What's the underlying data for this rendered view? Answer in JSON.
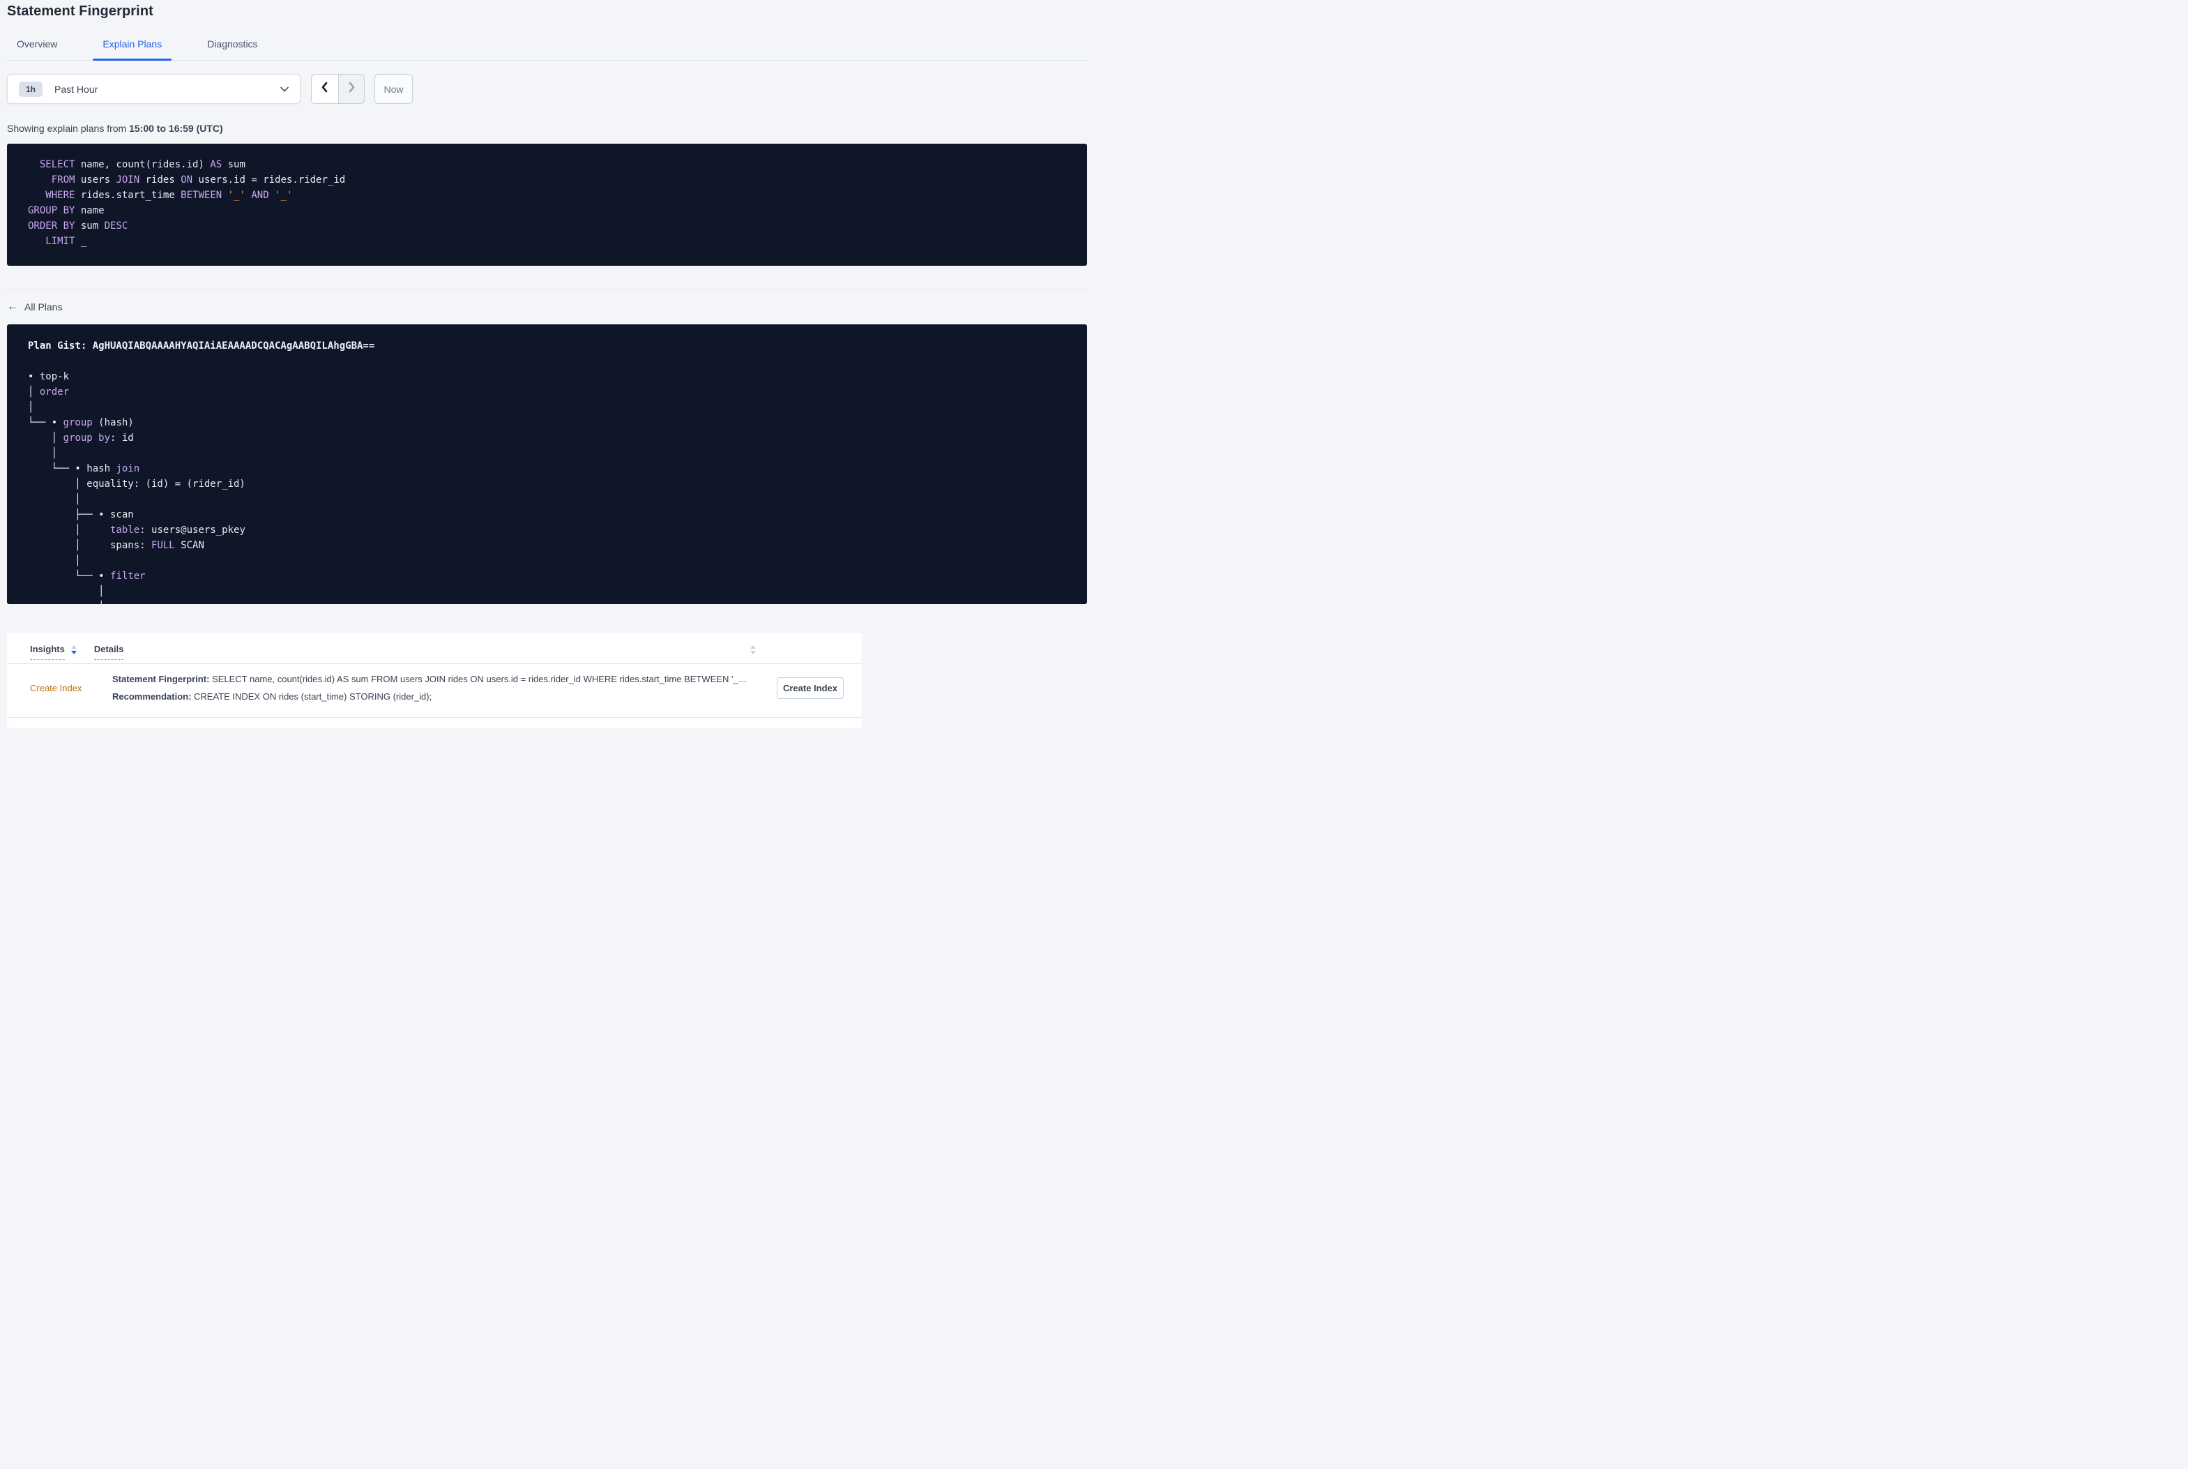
{
  "title": "Statement Fingerprint",
  "tabs": {
    "overview": "Overview",
    "explain_plans": "Explain Plans",
    "diagnostics": "Diagnostics"
  },
  "time_controls": {
    "badge": "1h",
    "selected": "Past Hour",
    "now": "Now"
  },
  "subtitle": {
    "prefix": "Showing explain plans from ",
    "range": "15:00 to 16:59 (UTC)"
  },
  "sql_box": {
    "lines": [
      [
        [
          "t",
          "  "
        ],
        [
          "k",
          "SELECT"
        ],
        [
          "t",
          " name, count(rides.id) "
        ],
        [
          "k",
          "AS"
        ],
        [
          "t",
          " sum"
        ]
      ],
      [
        [
          "t",
          "    "
        ],
        [
          "k",
          "FROM"
        ],
        [
          "t",
          " users "
        ],
        [
          "k",
          "JOIN"
        ],
        [
          "t",
          " rides "
        ],
        [
          "k",
          "ON"
        ],
        [
          "t",
          " users.id = rides.rider_id"
        ]
      ],
      [
        [
          "t",
          "   "
        ],
        [
          "k",
          "WHERE"
        ],
        [
          "t",
          " rides.start_time "
        ],
        [
          "k",
          "BETWEEN"
        ],
        [
          "t",
          " "
        ],
        [
          "s",
          "'_'"
        ],
        [
          "t",
          " "
        ],
        [
          "k",
          "AND"
        ],
        [
          "t",
          " "
        ],
        [
          "s",
          "'_'"
        ]
      ],
      [
        [
          "k",
          "GROUP BY"
        ],
        [
          "t",
          " name"
        ]
      ],
      [
        [
          "k",
          "ORDER BY"
        ],
        [
          "t",
          " sum "
        ],
        [
          "k",
          "DESC"
        ]
      ],
      [
        [
          "t",
          "   "
        ],
        [
          "k",
          "LIMIT"
        ],
        [
          "t",
          " _"
        ]
      ]
    ]
  },
  "back_link": {
    "label": "All Plans"
  },
  "plan_box": {
    "lines": [
      [
        [
          "b",
          "Plan Gist: AgHUAQIABQAAAAHYAQIAiAEAAAADCQACAgAABQILAhgGBA=="
        ]
      ],
      [],
      [
        [
          "t",
          "• top-k"
        ]
      ],
      [
        [
          "t",
          "│ "
        ],
        [
          "k",
          "order"
        ]
      ],
      [
        [
          "t",
          "│"
        ]
      ],
      [
        [
          "t",
          "└── • "
        ],
        [
          "k",
          "group"
        ],
        [
          "t",
          " (hash)"
        ]
      ],
      [
        [
          "t",
          "    │ "
        ],
        [
          "k",
          "group by"
        ],
        [
          "t",
          ": id"
        ]
      ],
      [
        [
          "t",
          "    │"
        ]
      ],
      [
        [
          "t",
          "    └── • hash "
        ],
        [
          "k",
          "join"
        ]
      ],
      [
        [
          "t",
          "        │ equality: (id) = (rider_id)"
        ]
      ],
      [
        [
          "t",
          "        │"
        ]
      ],
      [
        [
          "t",
          "        ├── • scan"
        ]
      ],
      [
        [
          "t",
          "        │     "
        ],
        [
          "k",
          "table"
        ],
        [
          "t",
          ": users@users_pkey"
        ]
      ],
      [
        [
          "t",
          "        │     spans: "
        ],
        [
          "k",
          "FULL"
        ],
        [
          "t",
          " SCAN"
        ]
      ],
      [
        [
          "t",
          "        │"
        ]
      ],
      [
        [
          "t",
          "        └── • "
        ],
        [
          "k",
          "filter"
        ]
      ],
      [
        [
          "t",
          "            │"
        ]
      ],
      [
        [
          "t",
          "            │"
        ]
      ]
    ]
  },
  "insights": {
    "col_insights": "Insights",
    "col_details": "Details",
    "row": {
      "insight": "Create Index",
      "fp_label": "Statement Fingerprint:",
      "fp_text": " SELECT name, count(rides.id) AS sum FROM users JOIN rides ON users.id = rides.rider_id WHERE rides.start_time BETWEEN '_…",
      "rec_label": "Recommendation:",
      "rec_text": " CREATE INDEX ON rides (start_time) STORING (rider_id);",
      "action": "Create Index"
    }
  },
  "colors": {
    "accent_blue": "#2065f2",
    "code_bg": "#0e1627",
    "code_keyword": "#c9a7f0",
    "code_string": "#ea9a3e",
    "insight_link": "#bd720d",
    "page_bg": "#f4f5f9"
  }
}
